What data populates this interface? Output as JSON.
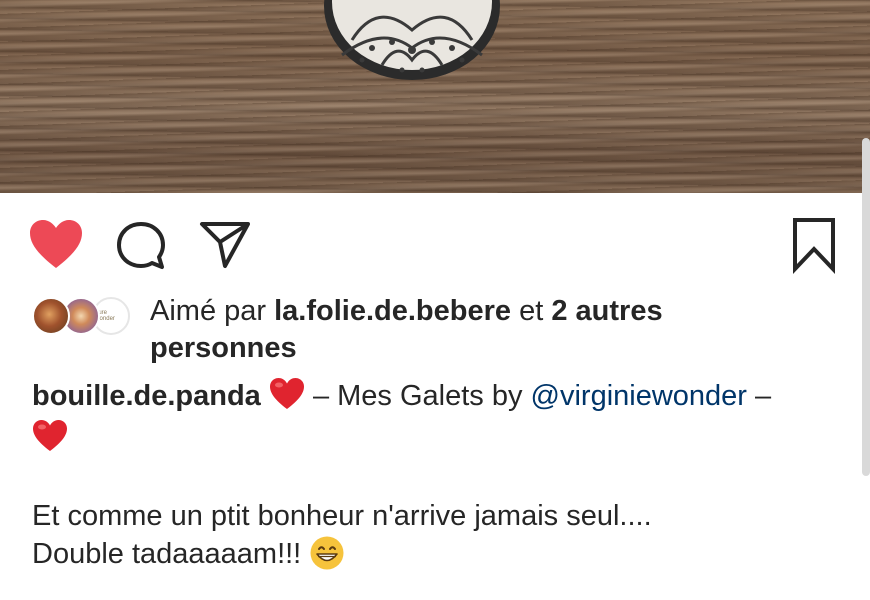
{
  "post": {
    "liked_by_prefix": "Aimé par",
    "liked_by_user": "la.folie.de.bebere",
    "liked_by_connector": "et",
    "liked_by_others": "2 autres personnes",
    "caption": {
      "username": "bouille.de.panda",
      "text_before_mention": " – Mes Galets by ",
      "mention": "@virginiewonder",
      "text_after_mention": " –",
      "line2": "Et comme un ptit bonheur n'arrive jamais seul....",
      "line3": "Double tadaaaaam!!!"
    },
    "avatar3_text": "Cure Wonder"
  },
  "icons": {
    "like": "heart-filled-icon",
    "comment": "comment-bubble-icon",
    "share": "paper-plane-icon",
    "save": "bookmark-icon"
  },
  "colors": {
    "like_red": "#ed4956",
    "mention_blue": "#003569",
    "text": "#262626"
  }
}
